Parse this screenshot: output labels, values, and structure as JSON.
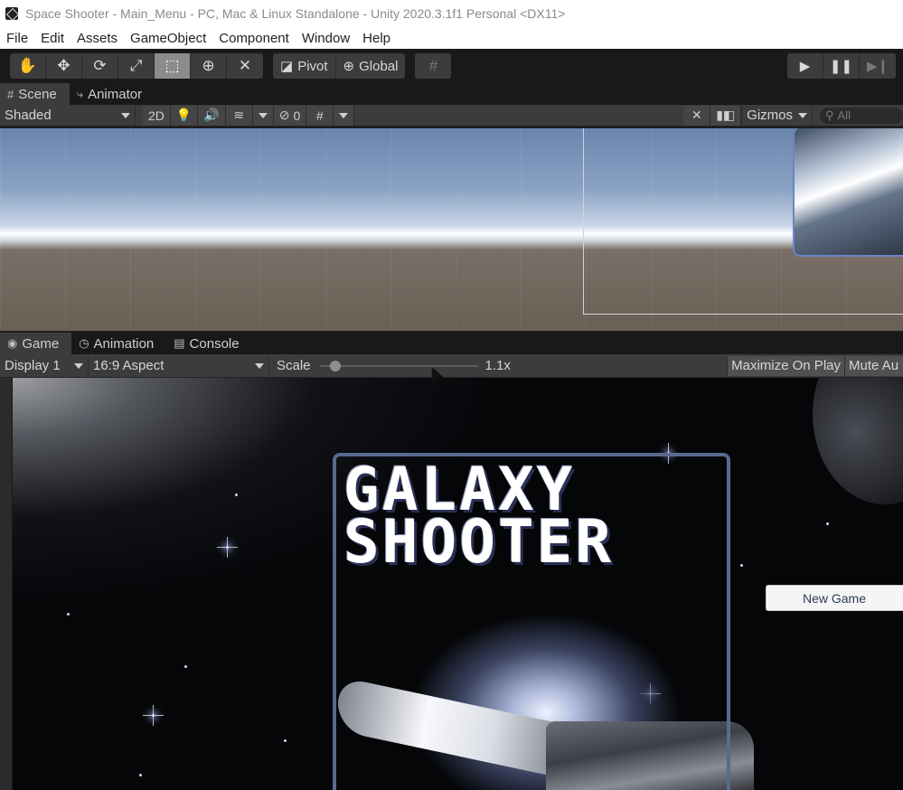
{
  "window": {
    "title": "Space Shooter - Main_Menu - PC, Mac & Linux Standalone - Unity 2020.3.1f1 Personal <DX11>"
  },
  "menu": [
    "File",
    "Edit",
    "Assets",
    "GameObject",
    "Component",
    "Window",
    "Help"
  ],
  "toolbar": {
    "tools": [
      {
        "name": "hand-tool",
        "glyph": "✋"
      },
      {
        "name": "move-tool",
        "glyph": "✥"
      },
      {
        "name": "rotate-tool",
        "glyph": "⟳"
      },
      {
        "name": "scale-tool",
        "glyph": "⤢"
      },
      {
        "name": "rect-tool",
        "glyph": "⬚"
      },
      {
        "name": "transform-tool",
        "glyph": "⊕"
      },
      {
        "name": "custom-tool",
        "glyph": "✕"
      }
    ],
    "pivot_label": "Pivot",
    "global_label": "Global",
    "play_glyphs": [
      "▶",
      "❚❚",
      "▶❙"
    ]
  },
  "scene_tabs": [
    {
      "label": "Scene",
      "icon": "#"
    },
    {
      "label": "Animator",
      "icon": "⤷"
    }
  ],
  "scene_controls": {
    "shading_mode": "Shaded",
    "mode_2d": "2D",
    "hidden_count": "0",
    "gizmos_label": "Gizmos",
    "search_placeholder": "All"
  },
  "game_tabs": [
    {
      "label": "Game",
      "icon": "◉"
    },
    {
      "label": "Animation",
      "icon": "◷"
    },
    {
      "label": "Console",
      "icon": "▤"
    }
  ],
  "game_controls": {
    "display": "Display 1",
    "aspect": "16:9 Aspect",
    "scale_label": "Scale",
    "scale_value": "1.1x",
    "scale_fraction": 0.07,
    "maximize_on_play": "Maximize On Play",
    "mute_audio": "Mute Au"
  },
  "game": {
    "title_line1": "GALAXY",
    "title_line2": "SHOOTER",
    "new_game_button": "New Game"
  },
  "colors": {
    "accent_selection": "#6a86c2",
    "panel_border": "#5a6a8f"
  }
}
